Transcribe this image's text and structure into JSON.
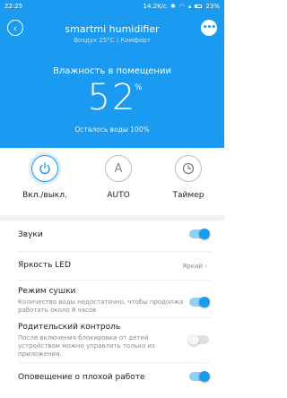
{
  "status_bar": {
    "time": "22:25",
    "network": "14.2K/с",
    "battery": "23%"
  },
  "header": {
    "title": "smartmi humidifier",
    "subtitle": "Воздух 25°C | Комфорт",
    "humidity_label": "Влажность в помещении",
    "humidity_value": "52",
    "humidity_unit": "%",
    "water_status": "Осталось воды 100%",
    "accent_color": "#1a9af0"
  },
  "controls": [
    {
      "label": "Вкл./выкл.",
      "icon": "power-icon",
      "active": true
    },
    {
      "label": "AUTO",
      "icon": "A",
      "active": false
    },
    {
      "label": "Таймер",
      "icon": "clock-icon",
      "active": false
    }
  ],
  "settings": {
    "sounds": {
      "label": "Звуки",
      "enabled": true
    },
    "led": {
      "label": "Яркость LED",
      "value": "Яркий"
    },
    "dry_mode": {
      "label": "Режим сушки",
      "description": "Количество воды недостаточно, чтобы продолжа работать около 8 часов",
      "enabled": true
    },
    "parental": {
      "label": "Родительский контроль",
      "description": "После включения блокировки от детей устройством можно управлять только из приложения.",
      "enabled": false
    },
    "fault_alert": {
      "label": "Оповещение о плохой работе",
      "enabled": true
    }
  }
}
